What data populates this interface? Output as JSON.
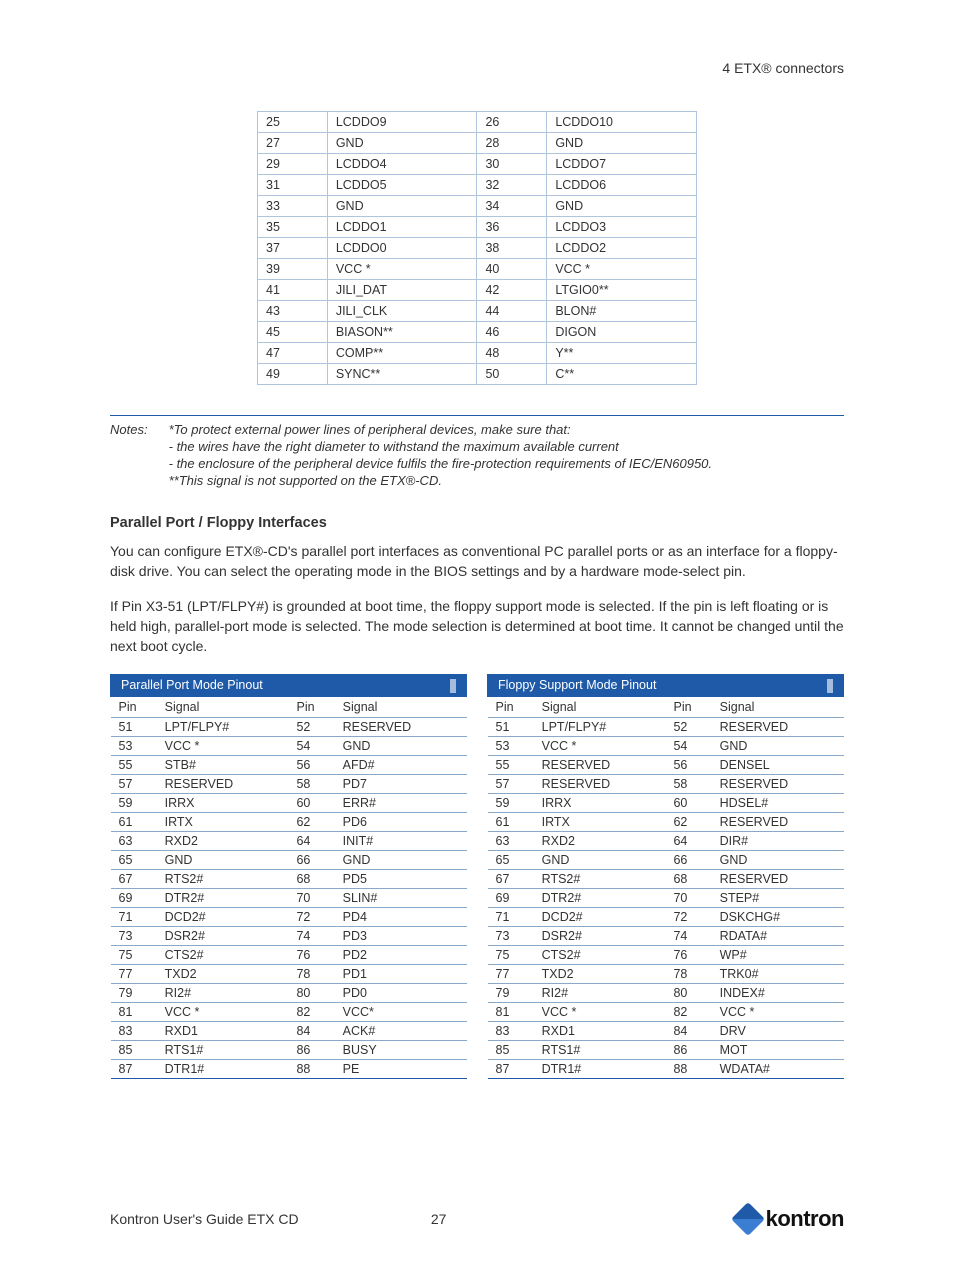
{
  "header": {
    "title": "4 ETX® connectors"
  },
  "topTable": [
    [
      "25",
      "LCDDO9",
      "26",
      "LCDDO10"
    ],
    [
      "27",
      "GND",
      "28",
      "GND"
    ],
    [
      "29",
      "LCDDO4",
      "30",
      "LCDDO7"
    ],
    [
      "31",
      "LCDDO5",
      "32",
      "LCDDO6"
    ],
    [
      "33",
      "GND",
      "34",
      "GND"
    ],
    [
      "35",
      "LCDDO1",
      "36",
      "LCDDO3"
    ],
    [
      "37",
      "LCDDO0",
      "38",
      "LCDDO2"
    ],
    [
      "39",
      "VCC *",
      "40",
      "VCC *"
    ],
    [
      "41",
      "JILI_DAT",
      "42",
      "LTGIO0**"
    ],
    [
      "43",
      "JILI_CLK",
      "44",
      "BLON#"
    ],
    [
      "45",
      "BIASON**",
      "46",
      "DIGON"
    ],
    [
      "47",
      "COMP**",
      "48",
      "Y**"
    ],
    [
      "49",
      "SYNC**",
      "50",
      "C**"
    ]
  ],
  "notes": {
    "label": "Notes:",
    "lines": [
      "*To protect external power lines of peripheral devices, make sure that:",
      "-  the wires have the right diameter to withstand the maximum available current",
      "-  the enclosure of the peripheral device fulfils the fire-protection requirements of IEC/EN60950.",
      "**This signal is not supported on the ETX®-CD."
    ]
  },
  "sectionTitle": "Parallel Port / Floppy Interfaces",
  "para1": "You can configure ETX®-CD's parallel port interfaces as conventional PC parallel ports or as an interface for a floppy-disk drive. You can select the operating mode in the BIOS settings and by a hardware mode-select pin.",
  "para2": "If Pin X3-51 (LPT/FLPY#) is grounded at boot time, the floppy support mode is selected. If the pin is left floating or is held high, parallel-port mode is selected. The mode selection is determined at boot time. It cannot be changed until the next boot cycle.",
  "tableA": {
    "title": "Parallel Port Mode Pinout",
    "cols": [
      "Pin",
      "Signal",
      "Pin",
      "Signal"
    ],
    "rows": [
      [
        "51",
        "LPT/FLPY#",
        "52",
        "RESERVED"
      ],
      [
        "53",
        "VCC *",
        "54",
        "GND"
      ],
      [
        "55",
        "STB#",
        "56",
        "AFD#"
      ],
      [
        "57",
        "RESERVED",
        "58",
        "PD7"
      ],
      [
        "59",
        "IRRX",
        "60",
        "ERR#"
      ],
      [
        "61",
        "IRTX",
        "62",
        "PD6"
      ],
      [
        "63",
        "RXD2",
        "64",
        "INIT#"
      ],
      [
        "65",
        "GND",
        "66",
        "GND"
      ],
      [
        "67",
        "RTS2#",
        "68",
        "PD5"
      ],
      [
        "69",
        "DTR2#",
        "70",
        "SLIN#"
      ],
      [
        "71",
        "DCD2#",
        "72",
        "PD4"
      ],
      [
        "73",
        "DSR2#",
        "74",
        "PD3"
      ],
      [
        "75",
        "CTS2#",
        "76",
        "PD2"
      ],
      [
        "77",
        "TXD2",
        "78",
        "PD1"
      ],
      [
        "79",
        "RI2#",
        "80",
        "PD0"
      ],
      [
        "81",
        "VCC *",
        "82",
        "VCC*"
      ],
      [
        "83",
        "RXD1",
        "84",
        "ACK#"
      ],
      [
        "85",
        "RTS1#",
        "86",
        "BUSY"
      ],
      [
        "87",
        "DTR1#",
        "88",
        "PE"
      ]
    ]
  },
  "tableB": {
    "title": "Floppy Support Mode Pinout",
    "cols": [
      "Pin",
      "Signal",
      "Pin",
      "Signal"
    ],
    "rows": [
      [
        "51",
        "LPT/FLPY#",
        "52",
        "RESERVED"
      ],
      [
        "53",
        "VCC *",
        "54",
        "GND"
      ],
      [
        "55",
        "RESERVED",
        "56",
        "DENSEL"
      ],
      [
        "57",
        "RESERVED",
        "58",
        "RESERVED"
      ],
      [
        "59",
        "IRRX",
        "60",
        "HDSEL#"
      ],
      [
        "61",
        "IRTX",
        "62",
        "RESERVED"
      ],
      [
        "63",
        "RXD2",
        "64",
        "DIR#"
      ],
      [
        "65",
        "GND",
        "66",
        "GND"
      ],
      [
        "67",
        "RTS2#",
        "68",
        "RESERVED"
      ],
      [
        "69",
        "DTR2#",
        "70",
        "STEP#"
      ],
      [
        "71",
        "DCD2#",
        "72",
        "DSKCHG#"
      ],
      [
        "73",
        "DSR2#",
        "74",
        "RDATA#"
      ],
      [
        "75",
        "CTS2#",
        "76",
        "WP#"
      ],
      [
        "77",
        "TXD2",
        "78",
        "TRK0#"
      ],
      [
        "79",
        "RI2#",
        "80",
        "INDEX#"
      ],
      [
        "81",
        "VCC *",
        "82",
        "VCC *"
      ],
      [
        "83",
        "RXD1",
        "84",
        "DRV"
      ],
      [
        "85",
        "RTS1#",
        "86",
        "MOT"
      ],
      [
        "87",
        "DTR1#",
        "88",
        "WDATA#"
      ]
    ]
  },
  "footer": {
    "left": "Kontron User's Guide ETX CD",
    "page": "27",
    "brand": "kontron"
  }
}
